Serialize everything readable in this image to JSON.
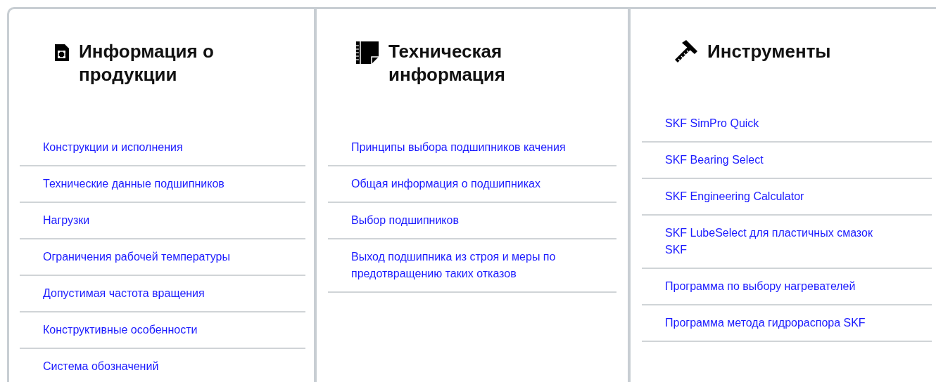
{
  "columns": [
    {
      "kind": "document",
      "title": "Информация о продукции",
      "links": [
        "Конструкции и исполнения",
        "Технические данные подшипников",
        "Нагрузки",
        "Ограничения рабочей температуры",
        "Допустимая частота вращения",
        "Конструктивные особенности",
        "Система обозначений"
      ]
    },
    {
      "kind": "ruler",
      "title": "Техническая информация",
      "links": [
        "Принципы выбора подшипников качения",
        "Общая информация о подшипниках",
        "Выбор подшипников",
        "Выход подшипника из строя и меры по предотвращению таких отказов"
      ]
    },
    {
      "kind": "tools",
      "title": "Инструменты",
      "links": [
        "SKF SimPro Quick",
        "SKF Bearing Select",
        "SKF Engineering Calculator",
        "SKF LubeSelect для пластичных смазок SKF",
        "Программа по выбору нагревателей",
        "Программа метода гидрораспора SKF"
      ]
    }
  ]
}
